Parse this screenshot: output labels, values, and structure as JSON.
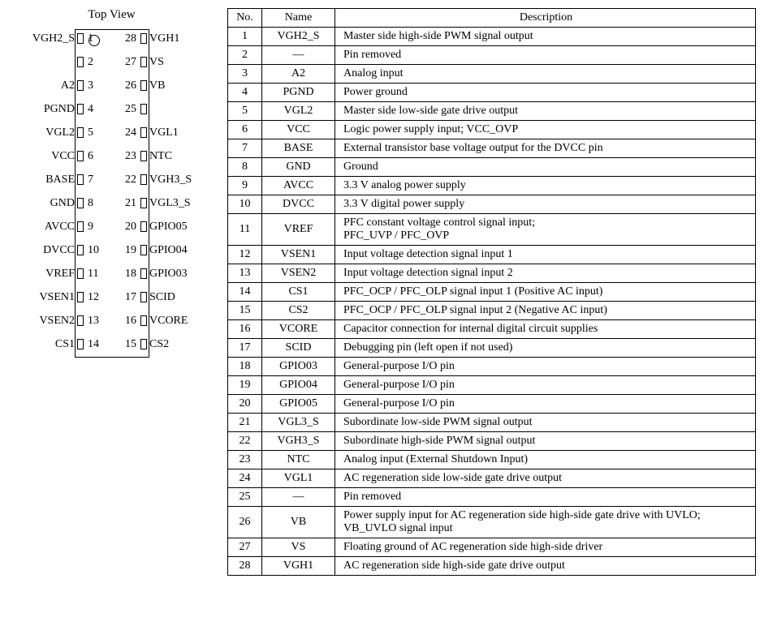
{
  "topViewLabel": "Top View",
  "headers": {
    "no": "No.",
    "name": "Name",
    "desc": "Description"
  },
  "leftPins": [
    {
      "num": "1",
      "label": "VGH2_S"
    },
    {
      "num": "2",
      "label": ""
    },
    {
      "num": "3",
      "label": "A2"
    },
    {
      "num": "4",
      "label": "PGND"
    },
    {
      "num": "5",
      "label": "VGL2"
    },
    {
      "num": "6",
      "label": "VCC"
    },
    {
      "num": "7",
      "label": "BASE"
    },
    {
      "num": "8",
      "label": "GND"
    },
    {
      "num": "9",
      "label": "AVCC"
    },
    {
      "num": "10",
      "label": "DVCC"
    },
    {
      "num": "11",
      "label": "VREF"
    },
    {
      "num": "12",
      "label": "VSEN1"
    },
    {
      "num": "13",
      "label": "VSEN2"
    },
    {
      "num": "14",
      "label": "CS1"
    }
  ],
  "rightPins": [
    {
      "num": "28",
      "label": "VGH1"
    },
    {
      "num": "27",
      "label": "VS"
    },
    {
      "num": "26",
      "label": "VB"
    },
    {
      "num": "25",
      "label": ""
    },
    {
      "num": "24",
      "label": "VGL1"
    },
    {
      "num": "23",
      "label": "NTC"
    },
    {
      "num": "22",
      "label": "VGH3_S"
    },
    {
      "num": "21",
      "label": "VGL3_S"
    },
    {
      "num": "20",
      "label": "GPIO05"
    },
    {
      "num": "19",
      "label": "GPIO04"
    },
    {
      "num": "18",
      "label": "GPIO03"
    },
    {
      "num": "17",
      "label": "SCID"
    },
    {
      "num": "16",
      "label": "VCORE"
    },
    {
      "num": "15",
      "label": "CS2"
    }
  ],
  "rows": [
    {
      "no": "1",
      "name": "VGH2_S",
      "desc": "Master side high-side PWM signal output"
    },
    {
      "no": "2",
      "name": "―",
      "desc": "Pin removed"
    },
    {
      "no": "3",
      "name": "A2",
      "desc": "Analog input"
    },
    {
      "no": "4",
      "name": "PGND",
      "desc": "Power ground"
    },
    {
      "no": "5",
      "name": "VGL2",
      "desc": "Master side low-side gate drive output"
    },
    {
      "no": "6",
      "name": "VCC",
      "desc": "Logic power supply input; VCC_OVP"
    },
    {
      "no": "7",
      "name": "BASE",
      "desc": "External transistor base voltage output for the DVCC pin"
    },
    {
      "no": "8",
      "name": "GND",
      "desc": "Ground"
    },
    {
      "no": "9",
      "name": "AVCC",
      "desc": "3.3 V analog power supply"
    },
    {
      "no": "10",
      "name": "DVCC",
      "desc": "3.3 V digital power supply"
    },
    {
      "no": "11",
      "name": "VREF",
      "desc": "PFC constant voltage control signal input;\nPFC_UVP / PFC_OVP"
    },
    {
      "no": "12",
      "name": "VSEN1",
      "desc": "Input voltage detection signal input 1"
    },
    {
      "no": "13",
      "name": "VSEN2",
      "desc": "Input voltage detection signal input 2"
    },
    {
      "no": "14",
      "name": "CS1",
      "desc": "PFC_OCP / PFC_OLP signal input 1 (Positive AC input)"
    },
    {
      "no": "15",
      "name": "CS2",
      "desc": "PFC_OCP / PFC_OLP signal input 2 (Negative AC input)"
    },
    {
      "no": "16",
      "name": "VCORE",
      "desc": "Capacitor connection for internal digital circuit supplies"
    },
    {
      "no": "17",
      "name": "SCID",
      "desc": "Debugging pin (left open if not used)"
    },
    {
      "no": "18",
      "name": "GPIO03",
      "desc": "General-purpose I/O pin"
    },
    {
      "no": "19",
      "name": "GPIO04",
      "desc": "General-purpose I/O pin"
    },
    {
      "no": "20",
      "name": "GPIO05",
      "desc": "General-purpose I/O pin"
    },
    {
      "no": "21",
      "name": "VGL3_S",
      "desc": "Subordinate low-side PWM signal output"
    },
    {
      "no": "22",
      "name": "VGH3_S",
      "desc": "Subordinate high-side PWM signal output"
    },
    {
      "no": "23",
      "name": "NTC",
      "desc": "Analog input (External Shutdown Input)"
    },
    {
      "no": "24",
      "name": "VGL1",
      "desc": "AC regeneration side low-side gate drive output"
    },
    {
      "no": "25",
      "name": "―",
      "desc": "Pin removed"
    },
    {
      "no": "26",
      "name": "VB",
      "desc": "Power supply input for AC regeneration side high-side gate drive with UVLO; VB_UVLO signal input"
    },
    {
      "no": "27",
      "name": "VS",
      "desc": "Floating ground of AC regeneration side high-side driver"
    },
    {
      "no": "28",
      "name": "VGH1",
      "desc": "AC regeneration side high-side gate drive output"
    }
  ]
}
